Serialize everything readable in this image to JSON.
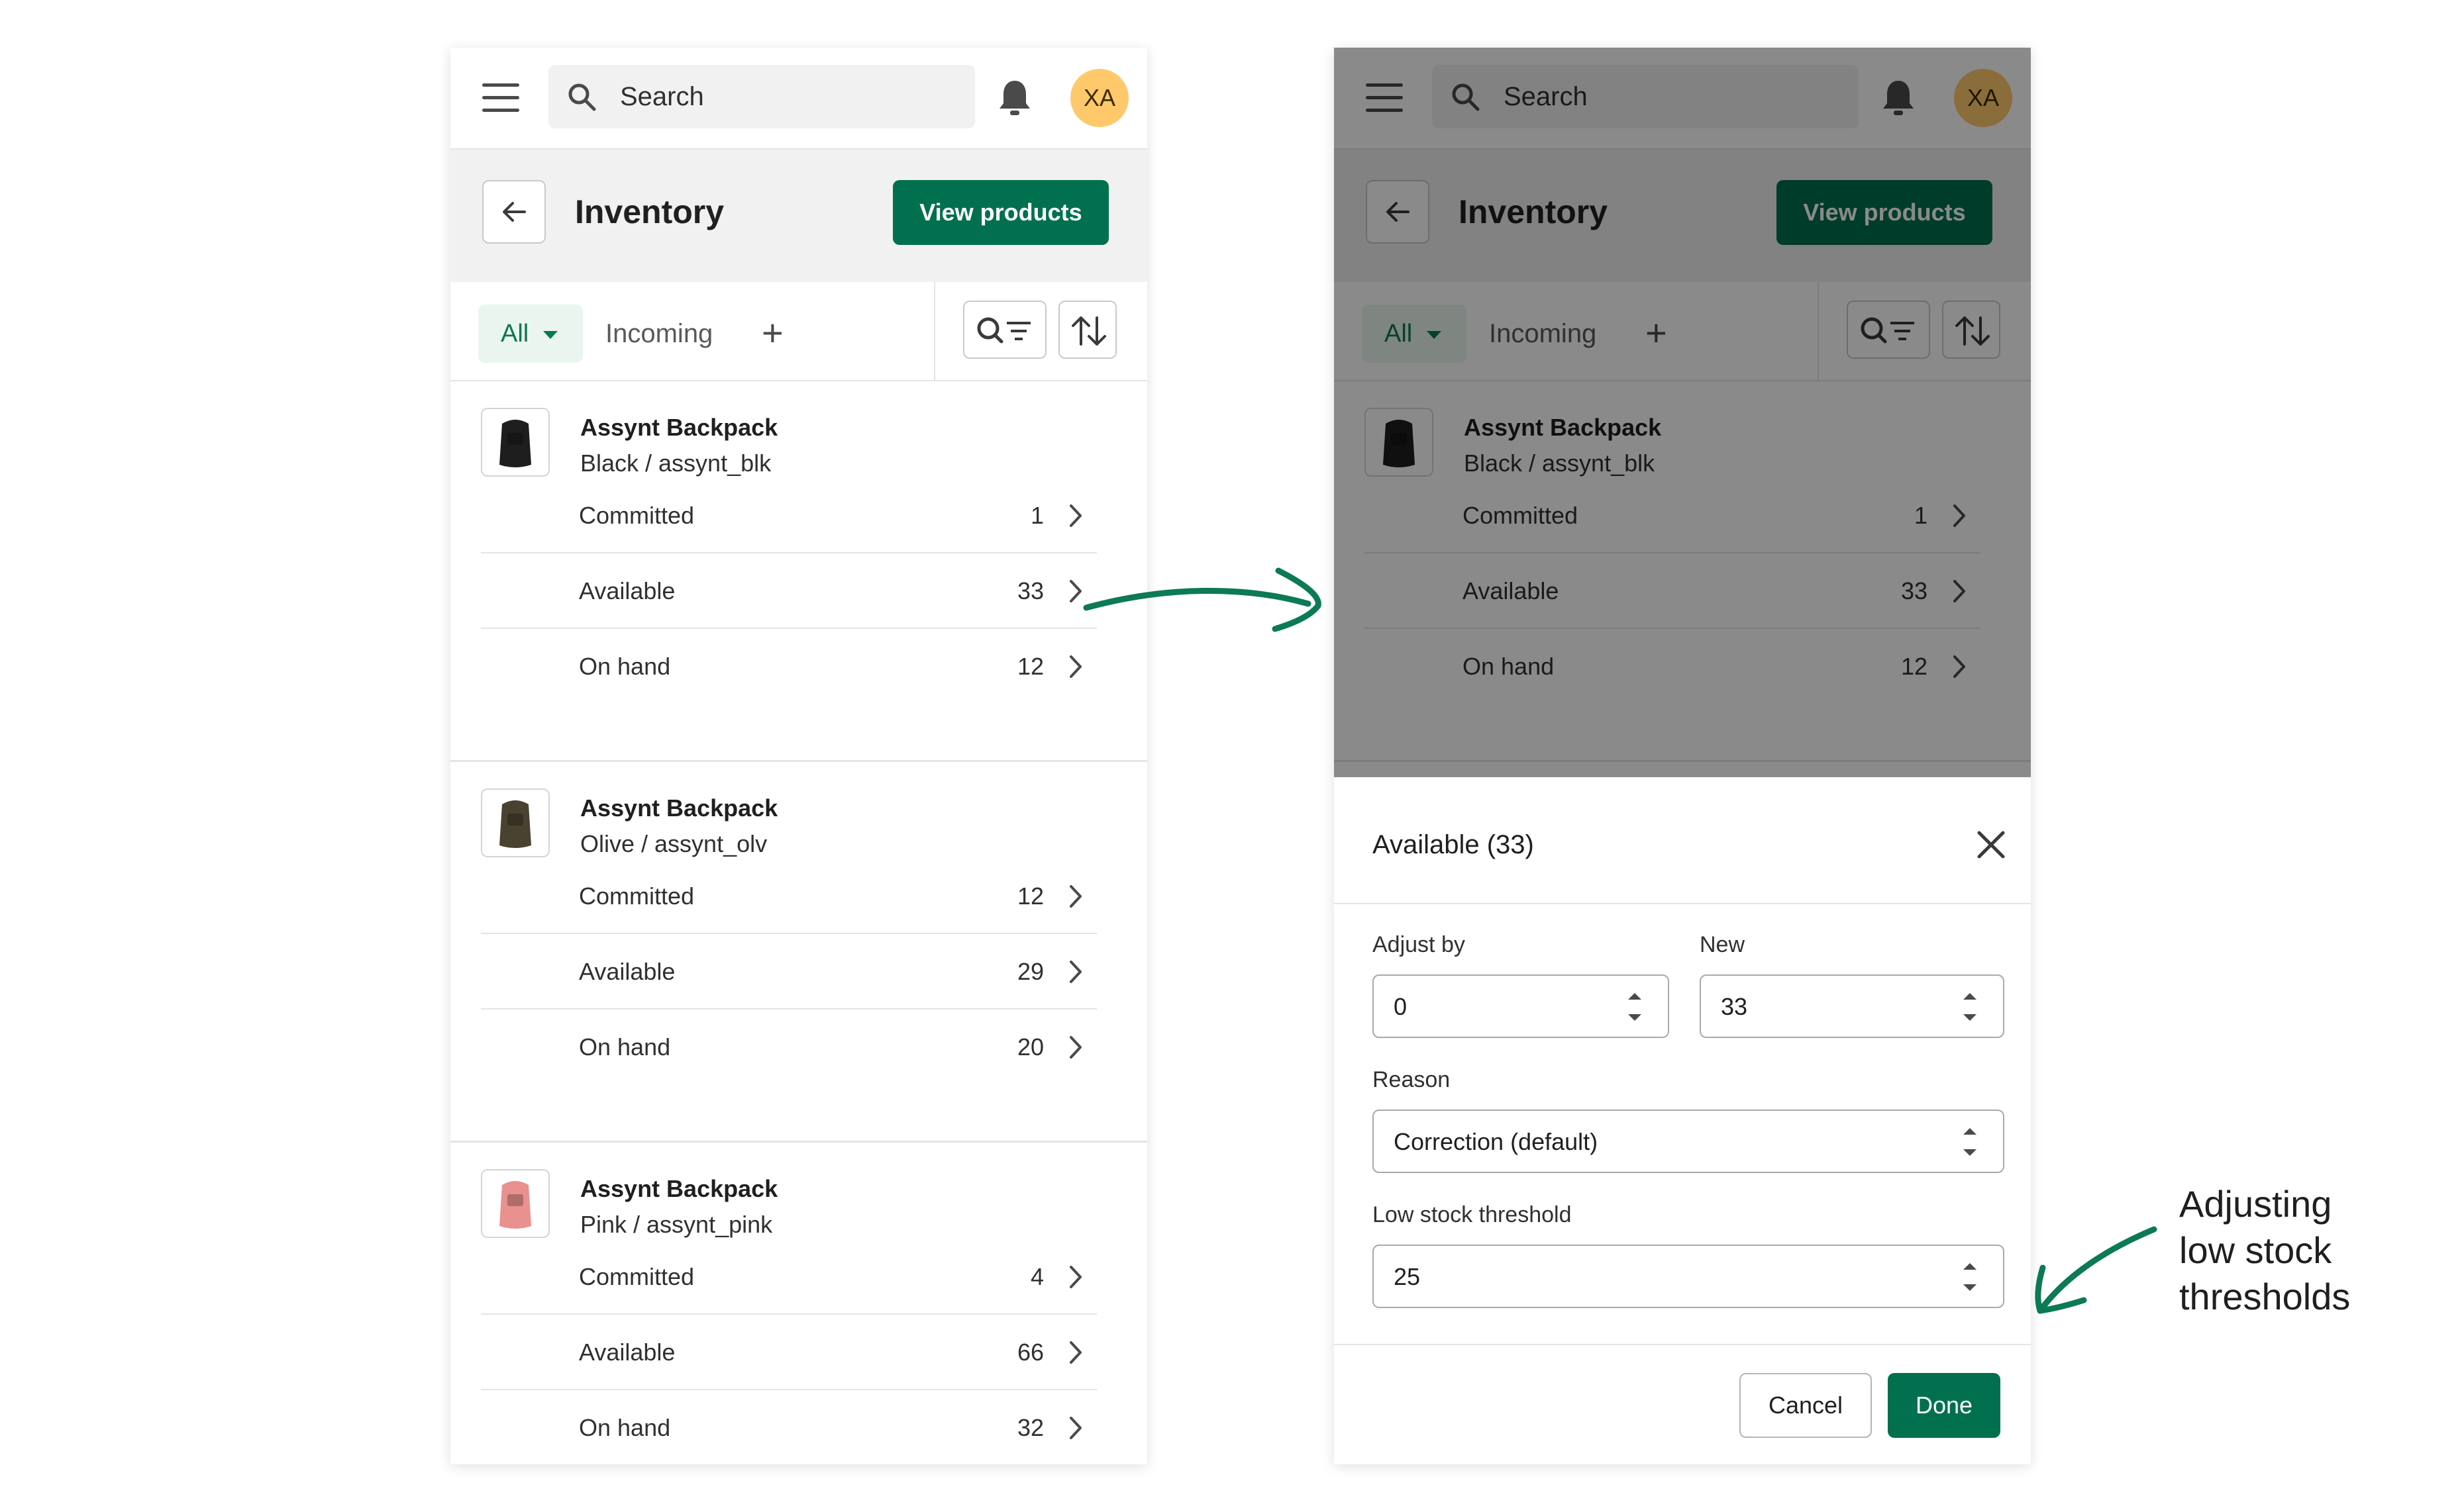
{
  "topbar": {
    "search_placeholder": "Search",
    "avatar_initials": "XA"
  },
  "page": {
    "title": "Inventory",
    "view_products_label": "View products"
  },
  "tabs": [
    {
      "label": "All",
      "selected": true
    },
    {
      "label": "Incoming",
      "selected": false
    }
  ],
  "tab_add_label": "+",
  "products": [
    {
      "name": "Assynt Backpack",
      "variant": "Black / assynt_blk",
      "thumb_color": "#1e1e1e",
      "rows": [
        {
          "label": "Committed",
          "value": "1"
        },
        {
          "label": "Available",
          "value": "33"
        },
        {
          "label": "On hand",
          "value": "12"
        }
      ]
    },
    {
      "name": "Assynt Backpack",
      "variant": "Olive / assynt_olv",
      "thumb_color": "#4a4230",
      "rows": [
        {
          "label": "Committed",
          "value": "12"
        },
        {
          "label": "Available",
          "value": "29"
        },
        {
          "label": "On hand",
          "value": "20"
        }
      ]
    },
    {
      "name": "Assynt Backpack",
      "variant": "Pink / assynt_pink",
      "thumb_color": "#e8918f",
      "rows": [
        {
          "label": "Committed",
          "value": "4"
        },
        {
          "label": "Available",
          "value": "66"
        },
        {
          "label": "On hand",
          "value": "32"
        }
      ]
    }
  ],
  "modal": {
    "title": "Available (33)",
    "adjust_by_label": "Adjust by",
    "adjust_by_value": "0",
    "new_label": "New",
    "new_value": "33",
    "reason_label": "Reason",
    "reason_value": "Correction (default)",
    "threshold_label": "Low stock threshold",
    "threshold_value": "25",
    "cancel_label": "Cancel",
    "done_label": "Done"
  },
  "annotation": {
    "lines": [
      "Adjusting",
      "low stock",
      "thresholds"
    ]
  },
  "colors": {
    "primary": "#00704e",
    "arrow": "#0b7a55",
    "avatar": "#ffc96b",
    "tab_selected": "#0a7a4e"
  }
}
